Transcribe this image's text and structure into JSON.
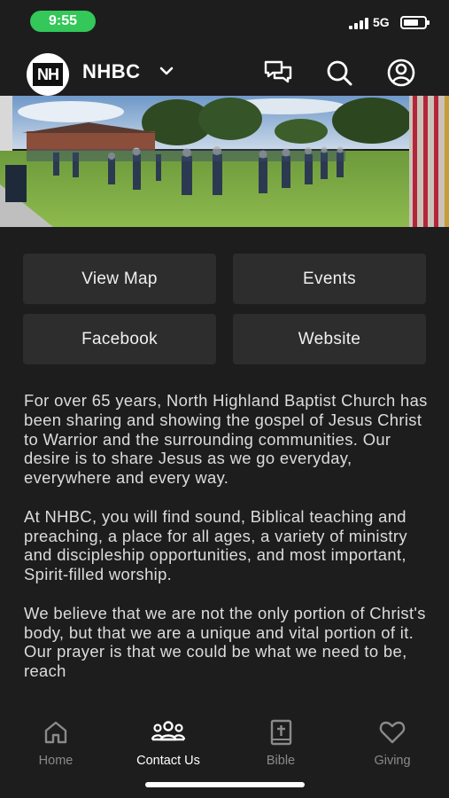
{
  "status_bar": {
    "time": "9:55",
    "network": "5G"
  },
  "header": {
    "logo_text": "NH",
    "org_name": "NHBC",
    "icons": [
      "chat-icon",
      "search-icon",
      "profile-icon"
    ]
  },
  "buttons": {
    "view_map": "View Map",
    "events": "Events",
    "facebook": "Facebook",
    "website": "Website"
  },
  "description": {
    "paragraphs": [
      "For over 65 years, North Highland Baptist Church has been sharing and showing the gospel of Jesus Christ to Warrior and the surrounding communities. Our desire is to share Jesus as we go everyday, everywhere and every way.",
      "At NHBC, you will find sound, Biblical teaching and preaching, a place for all ages, a variety of ministry and discipleship opportunities, and most important, Spirit-filled worship.",
      "We believe that we are not the only portion of Christ's body, but that we are a unique and vital portion of it. Our prayer is that we could be what we need to be, reach"
    ]
  },
  "tabs": [
    {
      "label": "Home",
      "icon": "home-icon",
      "active": false
    },
    {
      "label": "Contact Us",
      "icon": "people-icon",
      "active": true
    },
    {
      "label": "Bible",
      "icon": "bible-icon",
      "active": false
    },
    {
      "label": "Giving",
      "icon": "heart-icon",
      "active": false
    }
  ],
  "colors": {
    "background": "#1d1d1d",
    "button": "#2d2d2d",
    "time_pill": "#34c759"
  }
}
